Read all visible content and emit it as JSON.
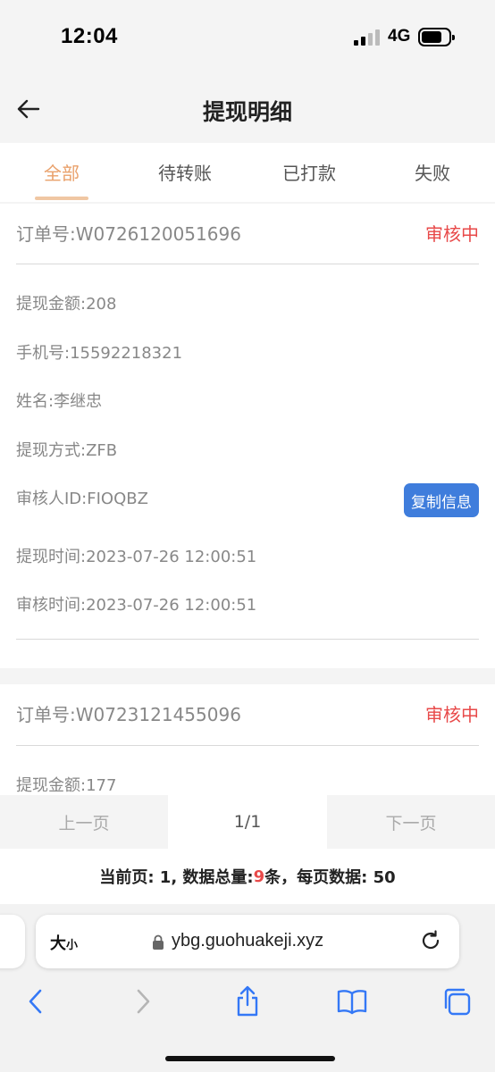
{
  "status_bar": {
    "time": "12:04",
    "network": "4G"
  },
  "nav": {
    "title": "提现明细"
  },
  "tabs": [
    {
      "label": "全部",
      "active": true
    },
    {
      "label": "待转账",
      "active": false
    },
    {
      "label": "已打款",
      "active": false
    },
    {
      "label": "失败",
      "active": false
    }
  ],
  "orders": [
    {
      "order_no": "订单号:W0726120051696",
      "status": "审核中",
      "amount": "提现金额:208",
      "phone": "手机号:15592218321",
      "name": "姓名:李继忠",
      "method": "提现方式:ZFB",
      "reviewer": "审核人ID:FIOQBZ",
      "copy_label": "复制信息",
      "withdraw_time": "提现时间:2023-07-26 12:00:51",
      "review_time": "审核时间:2023-07-26 12:00:51"
    },
    {
      "order_no": "订单号:W0723121455096",
      "status": "审核中",
      "amount": "提现金额:177"
    }
  ],
  "pager": {
    "prev": "上一页",
    "page": "1/1",
    "next": "下一页"
  },
  "summary": {
    "prefix": "当前页: 1, 数据总量:",
    "count": "9",
    "suffix": "条，每页数据: 50"
  },
  "browser": {
    "aa_big": "大",
    "aa_small": "小",
    "url": "ybg.guohuakeji.xyz"
  },
  "colors": {
    "accent": "#e9a06a",
    "status_red": "#e84a4a",
    "button_blue": "#3f7ddc",
    "ios_blue": "#3478f6"
  }
}
